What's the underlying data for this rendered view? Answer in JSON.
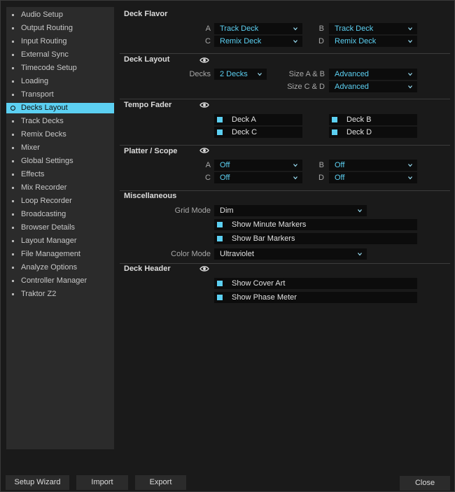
{
  "sidebar": {
    "items": [
      {
        "label": "Audio Setup"
      },
      {
        "label": "Output Routing"
      },
      {
        "label": "Input Routing"
      },
      {
        "label": "External Sync"
      },
      {
        "label": "Timecode Setup"
      },
      {
        "label": "Loading"
      },
      {
        "label": "Transport"
      },
      {
        "label": "Decks Layout"
      },
      {
        "label": "Track Decks"
      },
      {
        "label": "Remix Decks"
      },
      {
        "label": "Mixer"
      },
      {
        "label": "Global Settings"
      },
      {
        "label": "Effects"
      },
      {
        "label": "Mix Recorder"
      },
      {
        "label": "Loop Recorder"
      },
      {
        "label": "Broadcasting"
      },
      {
        "label": "Browser Details"
      },
      {
        "label": "Layout Manager"
      },
      {
        "label": "File Management"
      },
      {
        "label": "Analyze Options"
      },
      {
        "label": "Controller Manager"
      },
      {
        "label": "Traktor Z2"
      }
    ],
    "active": "Decks Layout"
  },
  "deck_flavor": {
    "title": "Deck Flavor",
    "a_label": "A",
    "a_value": "Track Deck",
    "b_label": "B",
    "b_value": "Track Deck",
    "c_label": "C",
    "c_value": "Remix Deck",
    "d_label": "D",
    "d_value": "Remix Deck"
  },
  "deck_layout": {
    "title": "Deck Layout",
    "decks_label": "Decks",
    "decks_value": "2 Decks",
    "size_ab_label": "Size A & B",
    "size_ab_value": "Advanced",
    "size_cd_label": "Size C & D",
    "size_cd_value": "Advanced"
  },
  "tempo_fader": {
    "title": "Tempo Fader",
    "deck_a": "Deck A",
    "deck_b": "Deck B",
    "deck_c": "Deck C",
    "deck_d": "Deck D"
  },
  "platter_scope": {
    "title": "Platter / Scope",
    "a_label": "A",
    "a_value": "Off",
    "b_label": "B",
    "b_value": "Off",
    "c_label": "C",
    "c_value": "Off",
    "d_label": "D",
    "d_value": "Off"
  },
  "misc": {
    "title": "Miscellaneous",
    "grid_mode_label": "Grid Mode",
    "grid_mode_value": "Dim",
    "show_minute_markers": "Show Minute Markers",
    "show_bar_markers": "Show Bar Markers",
    "color_mode_label": "Color Mode",
    "color_mode_value": "Ultraviolet"
  },
  "deck_header": {
    "title": "Deck Header",
    "show_cover_art": "Show Cover Art",
    "show_phase_meter": "Show Phase Meter"
  },
  "footer": {
    "setup_wizard": "Setup Wizard",
    "import": "Import",
    "export": "Export",
    "close": "Close"
  },
  "colors": {
    "accent": "#5cd0f2",
    "background": "#1a1a1a",
    "panel": "#2b2b2b",
    "field": "#0c0c0c"
  }
}
